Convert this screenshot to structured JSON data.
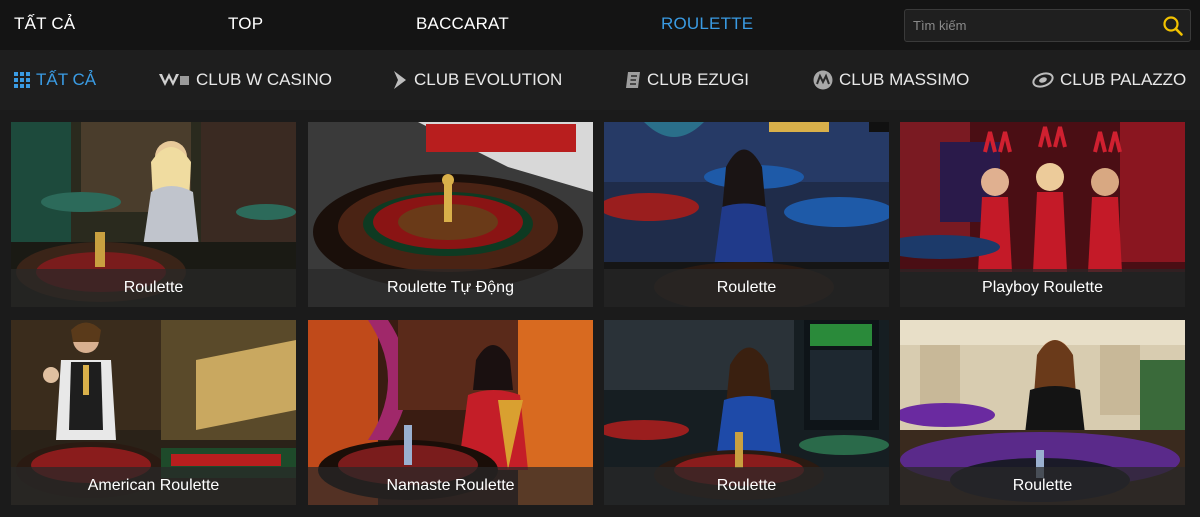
{
  "topnav": {
    "tabs": [
      {
        "label": "TẤT CẢ",
        "active": false
      },
      {
        "label": "TOP",
        "active": false
      },
      {
        "label": "BACCARAT",
        "active": false
      },
      {
        "label": "ROULETTE",
        "active": true
      }
    ],
    "search_placeholder": "Tìm kiếm"
  },
  "providers": [
    {
      "label": "TẤT CẢ",
      "icon": "grid-icon",
      "active": true
    },
    {
      "label": "CLUB W CASINO",
      "icon": "w-casino-logo-icon",
      "active": false
    },
    {
      "label": "CLUB EVOLUTION",
      "icon": "evolution-logo-icon",
      "active": false
    },
    {
      "label": "CLUB EZUGI",
      "icon": "ezugi-logo-icon",
      "active": false
    },
    {
      "label": "CLUB MASSIMO",
      "icon": "massimo-logo-icon",
      "active": false
    },
    {
      "label": "CLUB PALAZZO",
      "icon": "palazzo-logo-icon",
      "active": false
    }
  ],
  "games": [
    {
      "title": "Roulette"
    },
    {
      "title": "Roulette Tự Động"
    },
    {
      "title": "Roulette"
    },
    {
      "title": "Playboy Roulette"
    },
    {
      "title": "American Roulette"
    },
    {
      "title": "Namaste Roulette"
    },
    {
      "title": "Roulette"
    },
    {
      "title": "Roulette"
    }
  ],
  "colors": {
    "accent": "#3a9be3",
    "background": "#1b1b1b"
  }
}
